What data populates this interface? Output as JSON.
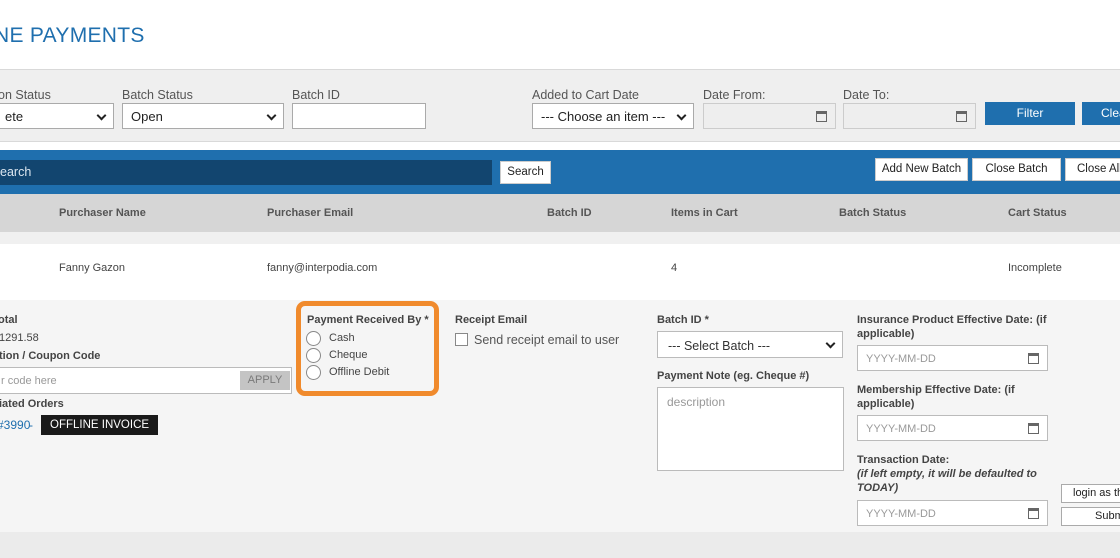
{
  "page": {
    "title": "NE PAYMENTS"
  },
  "filters": {
    "status_label": "on Status",
    "status_value": "ete",
    "batch_status_label": "Batch Status",
    "batch_status_value": "Open",
    "batch_id_label": "Batch ID",
    "batch_id_value": "",
    "added_to_cart_label": "Added to Cart Date",
    "added_to_cart_value": "--- Choose an item ---",
    "date_from_label": "Date From:",
    "date_to_label": "Date To:",
    "filter_button": "Filter",
    "clear_button": "Clea"
  },
  "toolbar": {
    "search_placeholder": "earch",
    "search_button": "Search",
    "add_new_batch": "Add New Batch",
    "close_batch": "Close Batch",
    "close_all": "Close All B"
  },
  "table": {
    "headers": [
      "Purchaser Name",
      "Purchaser Email",
      "Batch ID",
      "Items in Cart",
      "Batch Status",
      "Cart Status"
    ],
    "rows": [
      {
        "name": "Fanny Gazon",
        "email": "fanny@interpodia.com",
        "batch_id": "",
        "items": "4",
        "batch_status": "",
        "cart_status": "Incomplete"
      }
    ]
  },
  "detail": {
    "total_label": "otal",
    "total_value": "1291.58",
    "promo_label": "tion / Coupon Code",
    "promo_placeholder": "r code here",
    "apply_button": "APPLY",
    "related_label": "iated Orders",
    "order_link": "#3990",
    "order_sep": " -",
    "offline_badge": "OFFLINE INVOICE",
    "payment_label": "Payment Received By *",
    "payment_options": [
      "Cash",
      "Cheque",
      "Offline Debit"
    ],
    "receipt_label": "Receipt Email",
    "receipt_checkbox_label": "Send receipt email to user",
    "batch_id_label": "Batch ID *",
    "batch_select_value": "--- Select Batch ---",
    "payment_note_label": "Payment Note (eg. Cheque #)",
    "payment_note_placeholder": "description",
    "insurance_label_1": "Insurance Product Effective Date: (if",
    "insurance_label_2": "applicable)",
    "membership_label_1": "Membership Effective Date: (if",
    "membership_label_2": "applicable)",
    "transaction_label": "Transaction Date:",
    "transaction_note_1": "(if left empty, it will be defaulted to",
    "transaction_note_2": "TODAY)",
    "date_placeholder": "YYYY-MM-DD",
    "login_button": "login as thi",
    "submit_button": "Subm"
  },
  "colors": {
    "primary": "#1f6fae",
    "highlight": "#f08a2c",
    "dark_search": "#12456f"
  }
}
